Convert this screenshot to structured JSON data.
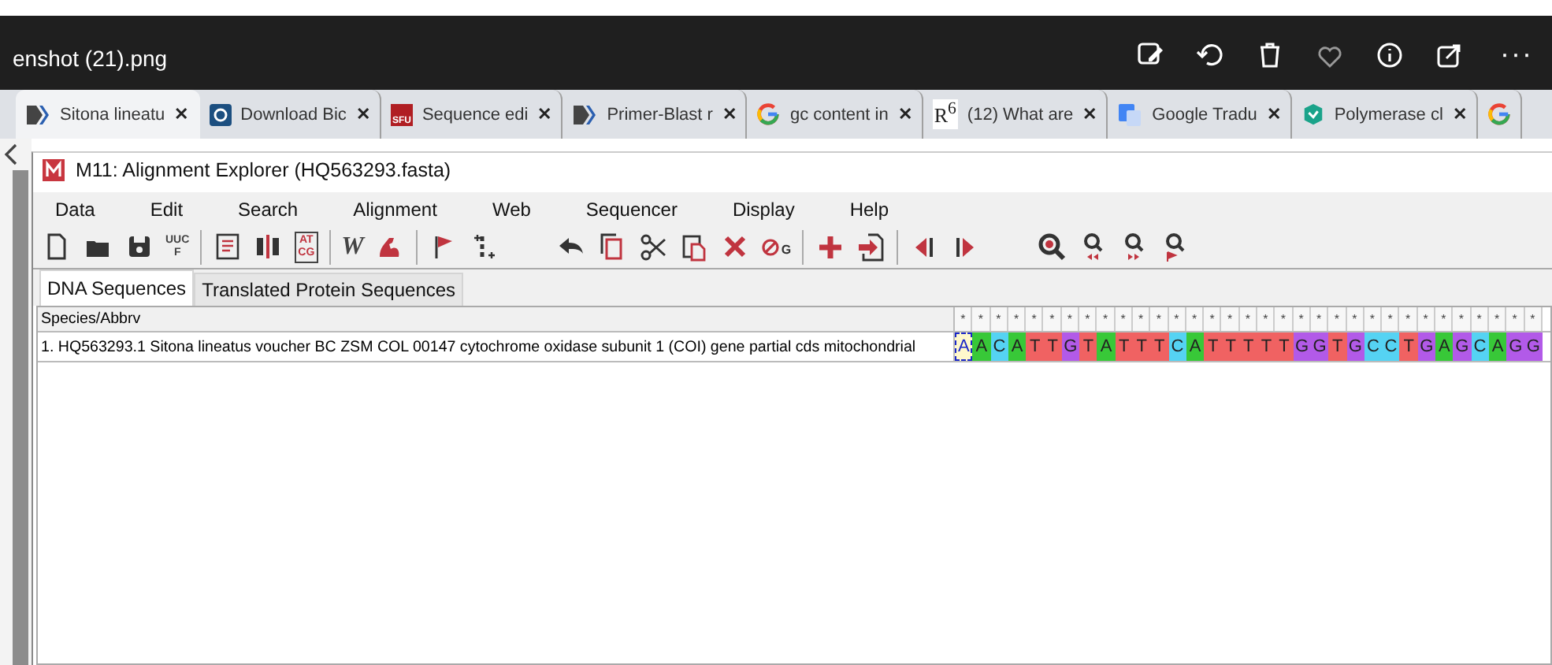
{
  "viewer": {
    "title": "enshot (21).png",
    "actions": [
      {
        "kind": "edit"
      },
      {
        "kind": "rotate"
      },
      {
        "kind": "trash"
      },
      {
        "kind": "heart"
      },
      {
        "kind": "info"
      },
      {
        "kind": "share"
      }
    ],
    "more": "···"
  },
  "browser_tabs": [
    {
      "label": "Sitona lineatu",
      "kind": "chevron",
      "close": "✕",
      "selected": true
    },
    {
      "label": "Download Bic",
      "kind": "q",
      "close": "✕",
      "selected": false
    },
    {
      "label": "Sequence edi",
      "kind": "sfu",
      "icon_text": "SFU",
      "close": "✕",
      "selected": false
    },
    {
      "label": "Primer-Blast r",
      "kind": "chevron",
      "close": "✕",
      "selected": false
    },
    {
      "label": "gc content in",
      "kind": "google",
      "close": "✕",
      "selected": false
    },
    {
      "label": "(12) What are",
      "kind": "rg",
      "icon_text": "R$^{6}$",
      "close": "✕",
      "selected": false
    },
    {
      "label": "Google Tradu",
      "kind": "translate",
      "close": "✕",
      "selected": false
    },
    {
      "label": "Polymerase cl",
      "kind": "shield",
      "close": "✕",
      "selected": false
    },
    {
      "kind": "google",
      "selected": false
    }
  ],
  "window": {
    "title": "M11: Alignment Explorer (HQ563293.fasta)",
    "menu": [
      "Data",
      "Edit",
      "Search",
      "Alignment",
      "Web",
      "Sequencer",
      "Display",
      "Help"
    ],
    "toolbar": [
      {
        "kind": "new"
      },
      {
        "kind": "open"
      },
      {
        "kind": "save"
      },
      {
        "kind": "uuc",
        "text": "UUC",
        "text2": "F"
      },
      {
        "kind": "sep"
      },
      {
        "kind": "list"
      },
      {
        "kind": "columns"
      },
      {
        "kind": "atcg",
        "text": "AT",
        "text2": "CG"
      },
      {
        "kind": "sep"
      },
      {
        "kind": "w",
        "text": "W"
      },
      {
        "kind": "arm"
      },
      {
        "kind": "sep"
      },
      {
        "kind": "flag"
      },
      {
        "kind": "gap"
      },
      {
        "kind": "space"
      },
      {
        "kind": "undo"
      },
      {
        "kind": "copy"
      },
      {
        "kind": "cut"
      },
      {
        "kind": "paste"
      },
      {
        "kind": "delete"
      },
      {
        "kind": "nogap",
        "text": "G"
      },
      {
        "kind": "sep"
      },
      {
        "kind": "plus"
      },
      {
        "kind": "import"
      },
      {
        "kind": "sep"
      },
      {
        "kind": "prev"
      },
      {
        "kind": "next"
      },
      {
        "kind": "space"
      },
      {
        "kind": "zoom"
      },
      {
        "kind": "findprev"
      },
      {
        "kind": "findnext"
      },
      {
        "kind": "findmark"
      }
    ],
    "tabs": [
      {
        "label": "DNA Sequences",
        "selected": true
      },
      {
        "label": "Translated Protein Sequences",
        "selected": false
      }
    ],
    "grid": {
      "name_header": "Species/Abbrv",
      "rows": [
        {
          "name": "1. HQ563293.1 Sitona lineatus voucher BC ZSM COL 00147 cytochrome oxidase subunit 1 (COI) gene partial cds mitochondrial",
          "sites": [
            {
              "mark": "*",
              "base": "A",
              "selected": true
            },
            {
              "mark": "*",
              "base": "A",
              "selected": false
            },
            {
              "mark": "*",
              "base": "C",
              "selected": false
            },
            {
              "mark": "*",
              "base": "A",
              "selected": false
            },
            {
              "mark": "*",
              "base": "T",
              "selected": false
            },
            {
              "mark": "*",
              "base": "T",
              "selected": false
            },
            {
              "mark": "*",
              "base": "G",
              "selected": false
            },
            {
              "mark": "*",
              "base": "T",
              "selected": false
            },
            {
              "mark": "*",
              "base": "A",
              "selected": false
            },
            {
              "mark": "*",
              "base": "T",
              "selected": false
            },
            {
              "mark": "*",
              "base": "T",
              "selected": false
            },
            {
              "mark": "*",
              "base": "T",
              "selected": false
            },
            {
              "mark": "*",
              "base": "C",
              "selected": false
            },
            {
              "mark": "*",
              "base": "A",
              "selected": false
            },
            {
              "mark": "*",
              "base": "T",
              "selected": false
            },
            {
              "mark": "*",
              "base": "T",
              "selected": false
            },
            {
              "mark": "*",
              "base": "T",
              "selected": false
            },
            {
              "mark": "*",
              "base": "T",
              "selected": false
            },
            {
              "mark": "*",
              "base": "T",
              "selected": false
            },
            {
              "mark": "*",
              "base": "G",
              "selected": false
            },
            {
              "mark": "*",
              "base": "G",
              "selected": false
            },
            {
              "mark": "*",
              "base": "T",
              "selected": false
            },
            {
              "mark": "*",
              "base": "G",
              "selected": false
            },
            {
              "mark": "*",
              "base": "C",
              "selected": false
            },
            {
              "mark": "*",
              "base": "C",
              "selected": false
            },
            {
              "mark": "*",
              "base": "T",
              "selected": false
            },
            {
              "mark": "*",
              "base": "G",
              "selected": false
            },
            {
              "mark": "*",
              "base": "A",
              "selected": false
            },
            {
              "mark": "*",
              "base": "G",
              "selected": false
            },
            {
              "mark": "*",
              "base": "C",
              "selected": false
            },
            {
              "mark": "*",
              "base": "A",
              "selected": false
            },
            {
              "mark": "*",
              "base": "G",
              "selected": false
            },
            {
              "mark": "*",
              "base": "G",
              "selected": false
            }
          ]
        }
      ]
    }
  }
}
